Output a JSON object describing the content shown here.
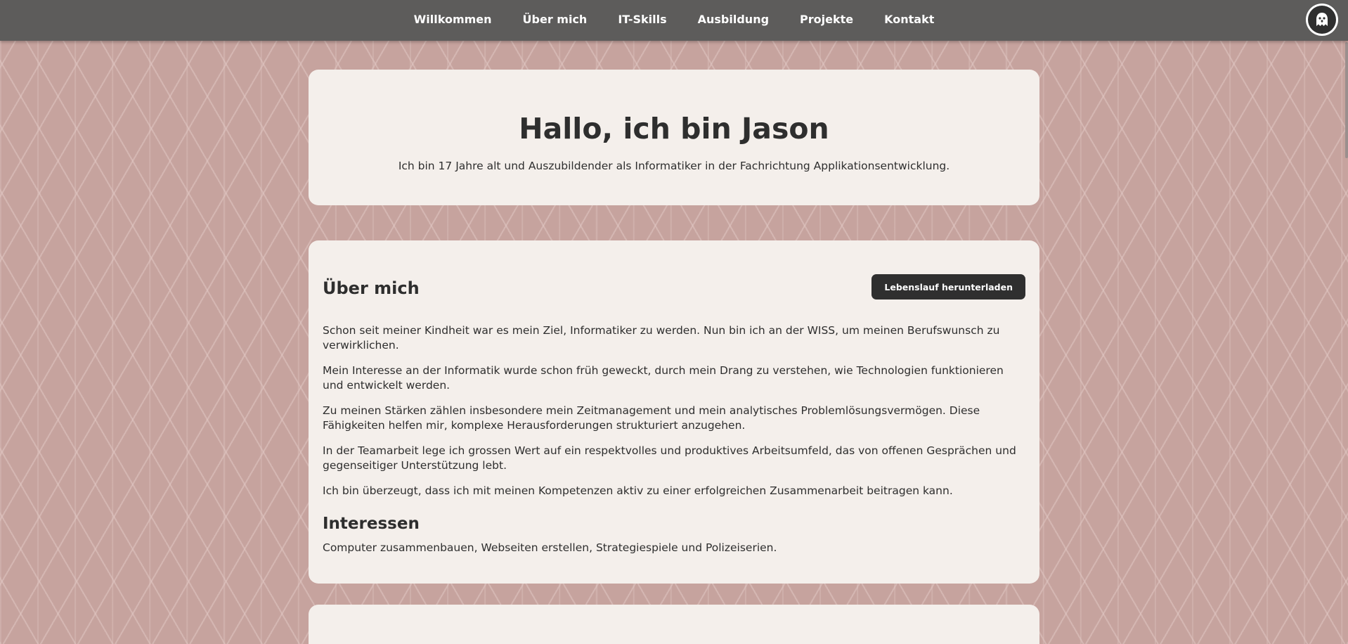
{
  "nav": {
    "items": [
      {
        "label": "Willkommen"
      },
      {
        "label": "Über mich"
      },
      {
        "label": "IT-Skills"
      },
      {
        "label": "Ausbildung"
      },
      {
        "label": "Projekte"
      },
      {
        "label": "Kontakt"
      }
    ],
    "profile_icon": "ghost-icon"
  },
  "hero": {
    "title": "Hallo, ich bin Jason",
    "subtitle": "Ich bin 17 Jahre alt und Auszubildender als Informatiker in der Fachrichtung Applikationsentwicklung."
  },
  "about": {
    "title": "Über mich",
    "cv_button_label": "Lebenslauf herunterladen",
    "paragraphs": [
      "Schon seit meiner Kindheit war es mein Ziel, Informatiker zu werden. Nun bin ich an der WISS, um meinen Berufswunsch zu verwirklichen.",
      "Mein Interesse an der Informatik wurde schon früh geweckt, durch mein Drang zu verstehen, wie Technologien funktionieren und entwickelt werden.",
      "Zu meinen Stärken zählen insbesondere mein Zeitmanagement und mein analytisches Problemlösungsvermögen. Diese Fähigkeiten helfen mir, komplexe Herausforderungen strukturiert anzugehen.",
      "In der Teamarbeit lege ich grossen Wert auf ein respektvolles und produktives Arbeitsumfeld, das von offenen Gesprächen und gegenseitiger Unterstützung lebt.",
      "Ich bin überzeugt, dass ich mit meinen Kompetenzen aktiv zu einer erfolgreichen Zusammenarbeit beitragen kann."
    ],
    "interests_title": "Interessen",
    "interests_text": "Computer zusammenbauen, Webseiten erstellen, Strategiespiele und Polizeiserien."
  },
  "colors": {
    "nav_background": "#5d5c5b",
    "page_background": "#c6a39e",
    "card_background": "#f4efeb",
    "button_background": "#2f2f2f",
    "text": "#2e2e2e"
  }
}
